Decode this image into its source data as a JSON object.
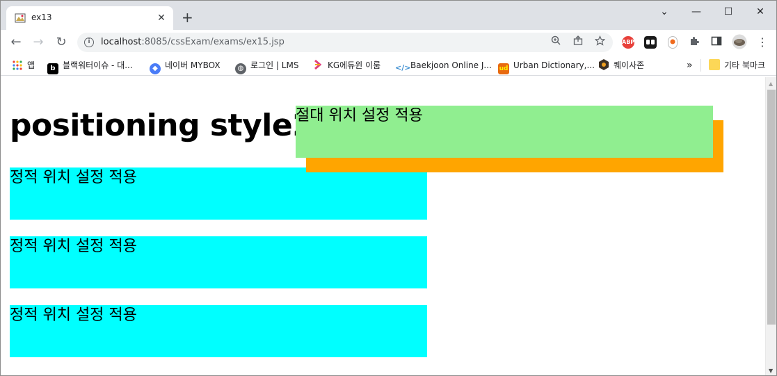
{
  "tab": {
    "title": "ex13",
    "close": "✕",
    "new": "+"
  },
  "window": {
    "minimize": "—",
    "maximize": "☐",
    "close": "✕",
    "dropdown": "⌄"
  },
  "toolbar": {
    "back": "←",
    "forward": "→",
    "reload": "↻",
    "url_host": "localhost",
    "url_path": ":8085/cssExam/exams/ex15.jsp"
  },
  "extensions": {
    "abp": "ABP"
  },
  "bookmarks": [
    {
      "label": "앱",
      "icon": "apps-grid-icon"
    },
    {
      "label": "블랙워터이슈 - 대...",
      "icon": "b-icon"
    },
    {
      "label": "네이버 MYBOX",
      "icon": "mybox-icon"
    },
    {
      "label": "로그인 | LMS",
      "icon": "globe-icon"
    },
    {
      "label": "KG에듀윈 이룸",
      "icon": "kg-icon"
    },
    {
      "label": "Baekjoon Online J...",
      "icon": "code-icon"
    },
    {
      "label": "Urban Dictionary,...",
      "icon": "ud-icon"
    },
    {
      "label": "퀘이사존",
      "icon": "quasar-icon"
    }
  ],
  "bookmarks_more": "»",
  "other_bookmarks": "기타 북마크",
  "page": {
    "heading": "positioning style2",
    "static_boxes": [
      "정적 위치 설정 적용",
      "정적 위치 설정 적용",
      "정적 위치 설정 적용"
    ],
    "absolute_box": "절대 위치 설정 적용"
  },
  "colors": {
    "static": "#00ffff",
    "absolute_front": "#90ee90",
    "absolute_back": "#ffa500"
  }
}
